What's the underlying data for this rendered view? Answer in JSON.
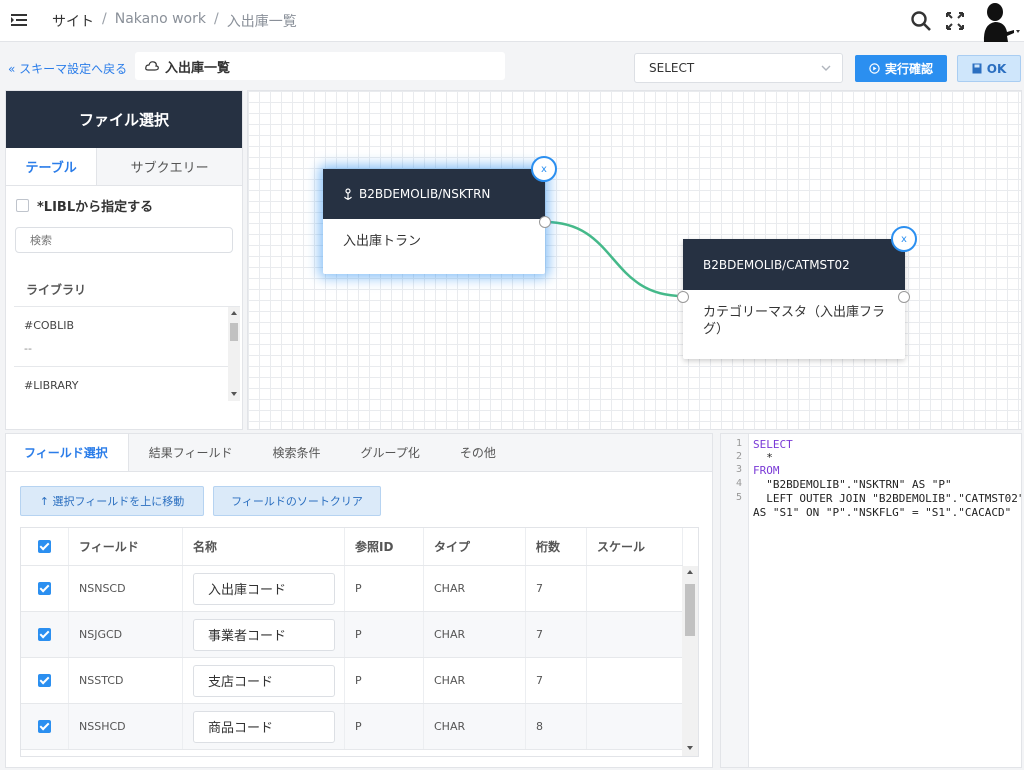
{
  "header": {
    "breadcrumb": [
      "サイト",
      "Nakano work",
      "入出庫一覧"
    ],
    "separator": "/"
  },
  "toolbar": {
    "back_label": "« スキーマ設定へ戻る",
    "title": "入出庫一覧",
    "select_value": "SELECT",
    "run_label": "実行確認",
    "ok_label": "OK"
  },
  "file_panel": {
    "title": "ファイル選択",
    "tabs": [
      "テーブル",
      "サブクエリー"
    ],
    "libl_label": "*LIBLから指定する",
    "search_placeholder": "検索",
    "library_label": "ライブラリ",
    "libraries": [
      {
        "name": "#COBLIB",
        "desc": "--"
      },
      {
        "name": "#LIBRARY",
        "desc": ""
      }
    ]
  },
  "canvas": {
    "nodes": [
      {
        "title": "B2BDEMOLIB/NSKTRN",
        "label": "入出庫トラン",
        "close": "x"
      },
      {
        "title": "B2BDEMOLIB/CATMST02",
        "label": "カテゴリーマスタ（入出庫フラグ）",
        "close": "x"
      }
    ]
  },
  "field_panel": {
    "tabs": [
      "フィールド選択",
      "結果フィールド",
      "検索条件",
      "グループ化",
      "その他"
    ],
    "move_up_label": "↑ 選択フィールドを上に移動",
    "sort_clear_label": "フィールドのソートクリア",
    "columns": [
      "フィールド",
      "名称",
      "参照ID",
      "タイプ",
      "桁数",
      "スケール"
    ],
    "rows": [
      {
        "field": "NSNSCD",
        "name": "入出庫コード",
        "ref": "P",
        "type": "CHAR",
        "digits": "7",
        "scale": ""
      },
      {
        "field": "NSJGCD",
        "name": "事業者コード",
        "ref": "P",
        "type": "CHAR",
        "digits": "7",
        "scale": ""
      },
      {
        "field": "NSSTCD",
        "name": "支店コード",
        "ref": "P",
        "type": "CHAR",
        "digits": "7",
        "scale": ""
      },
      {
        "field": "NSSHCD",
        "name": "商品コード",
        "ref": "P",
        "type": "CHAR",
        "digits": "8",
        "scale": ""
      }
    ]
  },
  "sql": {
    "line_numbers": [
      "1",
      "2",
      "3",
      "4",
      "5"
    ],
    "l1": "SELECT",
    "l2": "  *",
    "l3": "FROM",
    "l4": "  \"B2BDEMOLIB\".\"NSKTRN\" AS \"P\"",
    "l5a": "  LEFT OUTER JOIN \"B2BDEMOLIB\".\"CATMST02\"",
    "l5b": "AS \"S1\" ON \"P\".\"NSKFLG\" = \"S1\".\"CACACD\""
  },
  "colors": {
    "primary": "#2b8ff0",
    "node_header": "#263142",
    "link": "#45b98a"
  }
}
